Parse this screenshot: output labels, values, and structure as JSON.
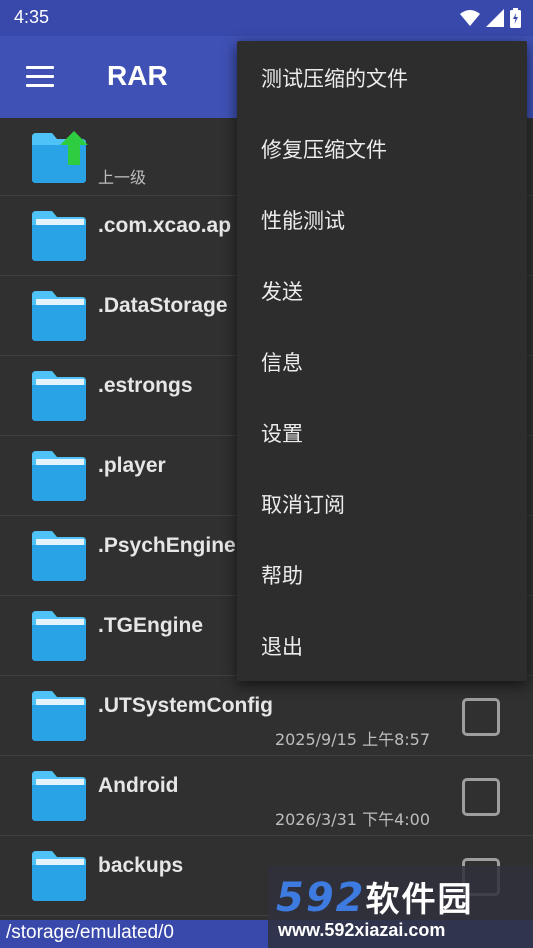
{
  "status": {
    "time": "4:35"
  },
  "app": {
    "title": "RAR"
  },
  "icons": {
    "menu": "hamburger-menu-icon",
    "folder": "folder-icon",
    "up": "up-arrow-icon"
  },
  "colors": {
    "toolbar": "#3f51b5",
    "folder": "#4fc3f7",
    "arrow": "#2ecc40",
    "background": "#303030"
  },
  "files": {
    "parent_label": "上一级",
    "items": [
      {
        "name": ".com.xcao.ap",
        "date": ""
      },
      {
        "name": ".DataStorage",
        "date": ""
      },
      {
        "name": ".estrongs",
        "date": ""
      },
      {
        "name": ".player",
        "date": ""
      },
      {
        "name": ".PsychEngine",
        "date": ""
      },
      {
        "name": ".TGEngine",
        "date": ""
      },
      {
        "name": ".UTSystemConfig",
        "date": "2025/9/15 上午8:57"
      },
      {
        "name": "Android",
        "date": "2026/3/31 下午4:00"
      },
      {
        "name": "backups",
        "date": ""
      }
    ]
  },
  "menu": {
    "items": [
      "测试压缩的文件",
      "修复压缩文件",
      "性能测试",
      "发送",
      "信息",
      "设置",
      "取消订阅",
      "帮助",
      "退出"
    ]
  },
  "path": "/storage/emulated/0",
  "watermark": {
    "logo_num": "592",
    "logo_cn": "软件园",
    "url": "www.592xiazai.com"
  }
}
